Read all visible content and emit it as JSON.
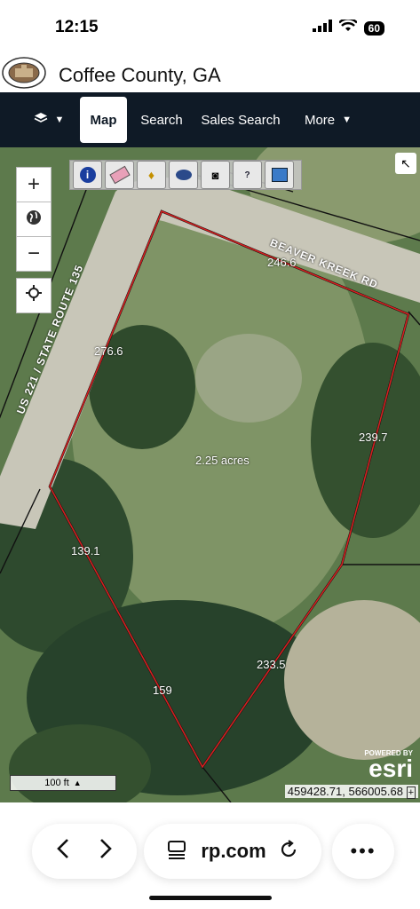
{
  "status": {
    "time": "12:15",
    "battery": "60"
  },
  "header": {
    "title": "Coffee County, GA",
    "logo_alt": "COFFEE COUNTY"
  },
  "nav": {
    "items": [
      {
        "label": "Map"
      },
      {
        "label": "Search"
      },
      {
        "label": "Sales Search"
      },
      {
        "label": "More"
      }
    ]
  },
  "map": {
    "roads": [
      "BEAVER KREEK RD",
      "US 221 / STATE ROUTE 135"
    ],
    "dimensions": [
      "246.6",
      "276.6",
      "239.7",
      "139.1",
      "233.5",
      "159"
    ],
    "area": "2.25 acres",
    "scale": "100 ft",
    "coordinates": "459428.71, 566005.68",
    "attribution_small": "POWERED BY",
    "attribution": "esri",
    "colors": {
      "parcel": "#d42020",
      "navbar": "#0f1a26"
    }
  },
  "browser": {
    "url": "rp.com"
  }
}
